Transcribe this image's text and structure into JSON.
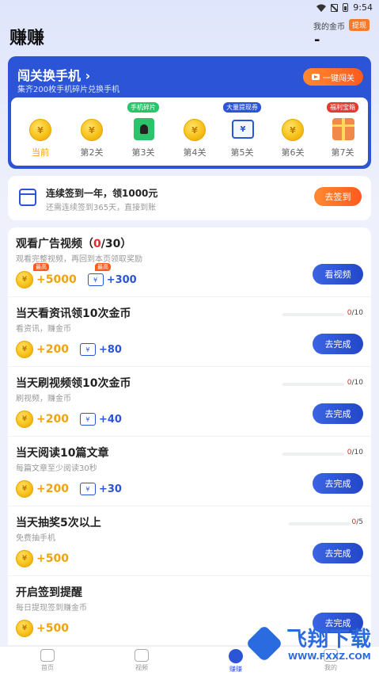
{
  "status": {
    "time": "9:54"
  },
  "header": {
    "title": "赚赚",
    "coins_label": "我的金币",
    "withdraw": "提现",
    "coins_value": "-"
  },
  "challenge": {
    "title": "闯关换手机",
    "chevron": "›",
    "subtitle": "集齐200枚手机碎片兑换手机",
    "button": "一键闯关",
    "levels": [
      {
        "label": "当前",
        "icon": "coin-icon",
        "tag": ""
      },
      {
        "label": "第2关",
        "icon": "coin-icon",
        "tag": ""
      },
      {
        "label": "第3关",
        "icon": "phone-fragment-icon",
        "tag": "手机碎片",
        "tag_color": "#2dc36b"
      },
      {
        "label": "第4关",
        "icon": "coin-icon",
        "tag": ""
      },
      {
        "label": "第5关",
        "icon": "coupon-icon",
        "tag": "大量提现券",
        "tag_color": "#2b55d6"
      },
      {
        "label": "第6关",
        "icon": "coin-icon",
        "tag": ""
      },
      {
        "label": "第7关",
        "icon": "gift-box-icon",
        "tag": "福利宝箱",
        "tag_color": "#e53b2c"
      }
    ]
  },
  "signin": {
    "title": "连续签到一年，领1000元",
    "subtitle": "还需连续签到365天，直接到账",
    "button": "去签到"
  },
  "coin_glyph": "¥",
  "tasks": [
    {
      "title": "观看广告视频",
      "prog_open": "（",
      "prog_cur": "0",
      "prog_total": "/30",
      "prog_close": "）",
      "desc": "观看完整视频，再回到本页领取奖励",
      "coin": "+5000",
      "ticket": "+300",
      "badge": "最高",
      "button": "看视频",
      "progress": null
    },
    {
      "title": "当天看资讯领10次金币",
      "desc": "看资讯，赚金币",
      "coin": "+200",
      "ticket": "+80",
      "button": "去完成",
      "progress": {
        "cur": "0",
        "total": "/10",
        "fraction": 0
      }
    },
    {
      "title": "当天刷视频领10次金币",
      "desc": "刷视频，赚金币",
      "coin": "+200",
      "ticket": "+40",
      "button": "去完成",
      "progress": {
        "cur": "0",
        "total": "/10",
        "fraction": 0
      }
    },
    {
      "title": "当天阅读10篇文章",
      "desc": "每篇文章至少阅读30秒",
      "coin": "+200",
      "ticket": "+30",
      "button": "去完成",
      "progress": {
        "cur": "0",
        "total": "/10",
        "fraction": 0
      }
    },
    {
      "title": "当天抽奖5次以上",
      "desc": "免费抽手机",
      "coin": "+500",
      "ticket": "",
      "button": "去完成",
      "progress": {
        "cur": "0",
        "total": "/5",
        "fraction": 0
      }
    },
    {
      "title": "开启签到提醒",
      "desc": "每日提现签到赚金币",
      "coin": "+500",
      "ticket": "",
      "button": "去完成",
      "progress": null
    }
  ],
  "nav": [
    {
      "label": "首页",
      "icon": "home-icon"
    },
    {
      "label": "视频",
      "icon": "video-icon"
    },
    {
      "label": "赚赚",
      "icon": "earn-icon",
      "active": true
    },
    {
      "label": "我的",
      "icon": "profile-icon"
    }
  ],
  "watermark": {
    "text": "飞翔下载",
    "url": "WWW.FXXZ.COM"
  }
}
